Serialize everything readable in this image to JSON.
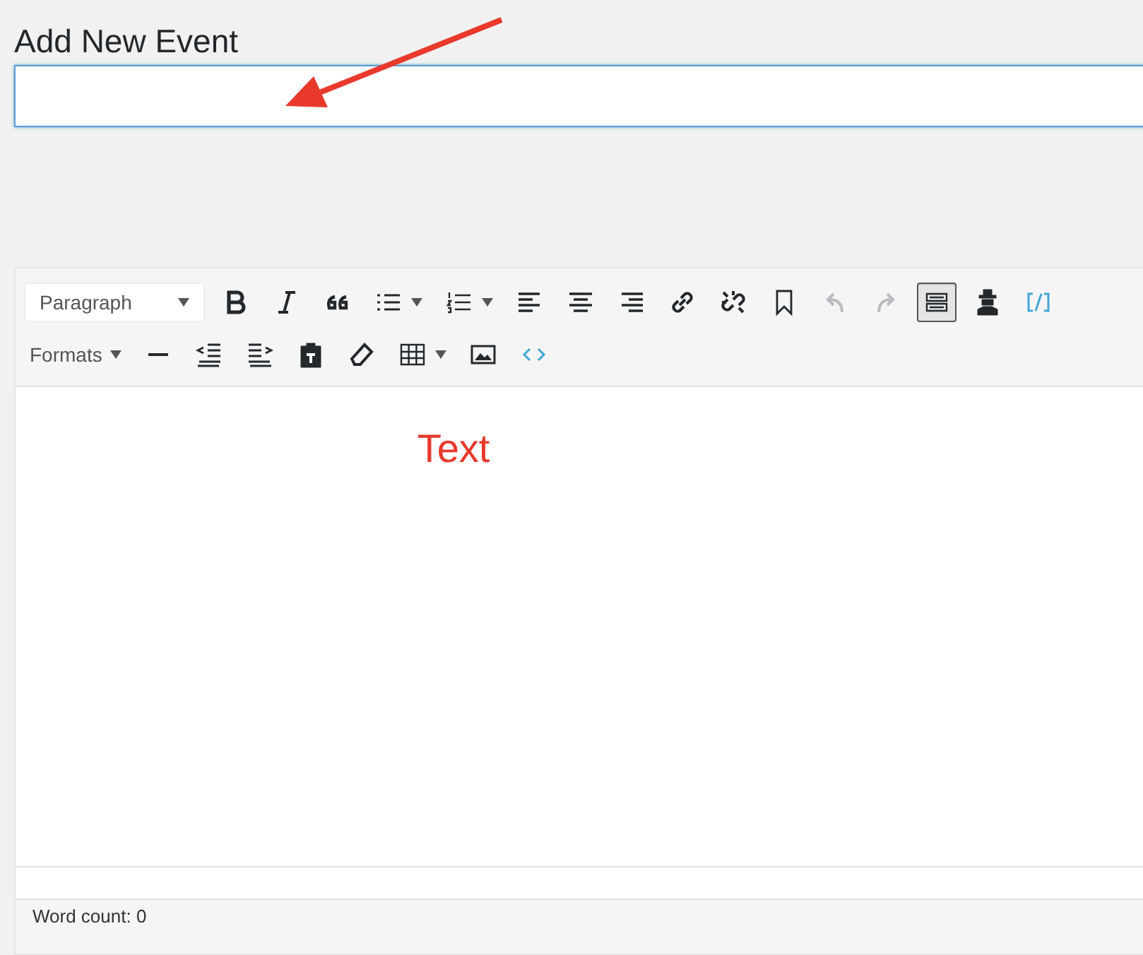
{
  "page_title": "Add New Event",
  "title_field": {
    "focused": true
  },
  "toolbar_rows": [
    [
      {
        "kind": "select",
        "label": "Paragraph",
        "menu": true,
        "disabled": false,
        "pressed": false
      },
      {
        "kind": "bold",
        "menu": false,
        "disabled": false,
        "pressed": false
      },
      {
        "kind": "italic",
        "menu": false,
        "disabled": false,
        "pressed": false
      },
      {
        "kind": "quote",
        "menu": false,
        "disabled": false,
        "pressed": false
      },
      {
        "kind": "bullets",
        "menu": true,
        "disabled": false,
        "pressed": false
      },
      {
        "kind": "numbers",
        "menu": true,
        "disabled": false,
        "pressed": false
      },
      {
        "kind": "align-left",
        "menu": false,
        "disabled": false,
        "pressed": false
      },
      {
        "kind": "align-center",
        "menu": false,
        "disabled": false,
        "pressed": false
      },
      {
        "kind": "align-right",
        "menu": false,
        "disabled": false,
        "pressed": false
      },
      {
        "kind": "link",
        "menu": false,
        "disabled": false,
        "pressed": false
      },
      {
        "kind": "unlink",
        "menu": false,
        "disabled": false,
        "pressed": false
      },
      {
        "kind": "bookmark",
        "menu": false,
        "disabled": false,
        "pressed": false
      },
      {
        "kind": "undo",
        "menu": false,
        "disabled": true,
        "pressed": false
      },
      {
        "kind": "redo",
        "menu": false,
        "disabled": true,
        "pressed": false
      },
      {
        "kind": "keyboard",
        "menu": false,
        "disabled": false,
        "pressed": true
      },
      {
        "kind": "hat",
        "menu": false,
        "disabled": false,
        "pressed": false
      },
      {
        "kind": "shortcode",
        "menu": false,
        "disabled": false,
        "pressed": false
      }
    ],
    [
      {
        "kind": "text",
        "label": "Formats",
        "menu": true,
        "disabled": false,
        "pressed": false
      },
      {
        "kind": "rule",
        "menu": false,
        "disabled": false,
        "pressed": false
      },
      {
        "kind": "outdent",
        "menu": false,
        "disabled": false,
        "pressed": false
      },
      {
        "kind": "indent",
        "menu": false,
        "disabled": false,
        "pressed": false
      },
      {
        "kind": "paste",
        "menu": false,
        "disabled": false,
        "pressed": false
      },
      {
        "kind": "eraser",
        "menu": false,
        "disabled": false,
        "pressed": false
      },
      {
        "kind": "table",
        "menu": true,
        "disabled": false,
        "pressed": false
      },
      {
        "kind": "image",
        "menu": false,
        "disabled": false,
        "pressed": false
      },
      {
        "kind": "code",
        "menu": false,
        "disabled": false,
        "pressed": false
      }
    ]
  ],
  "annotation": {
    "label": "Text"
  },
  "status_bar": {
    "word_count": "Word count: 0"
  }
}
